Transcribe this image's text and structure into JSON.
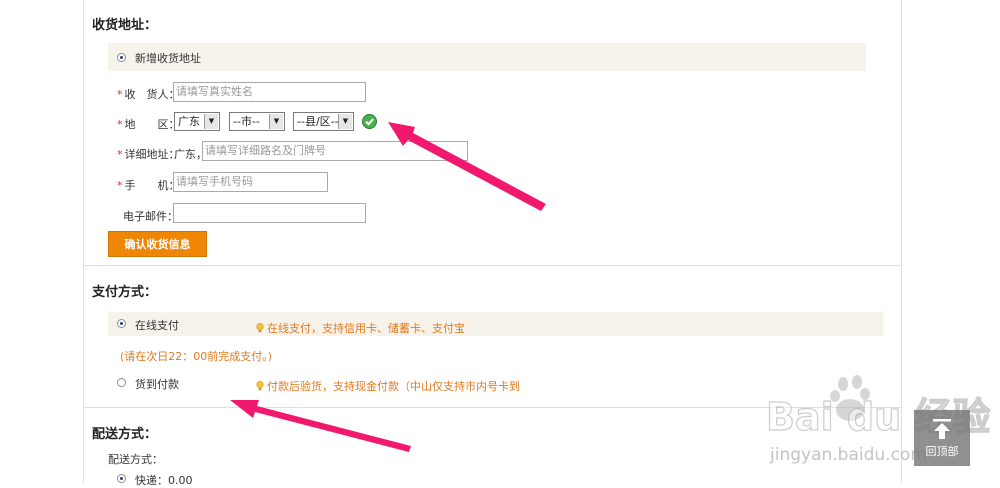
{
  "address_section": {
    "title": "收货地址：",
    "new_address_label": "新增收货地址",
    "receiver_label": "收　货人：",
    "receiver_placeholder": "请填写真实姓名",
    "region_label": "地　　区：",
    "province_selected": "广东",
    "city_selected": "--市--",
    "county_selected": "--县/区--",
    "detail_label": "详细地址：",
    "detail_prefix": "广东，",
    "detail_placeholder": "请填写详细路名及门牌号",
    "mobile_label": "手　　机：",
    "mobile_placeholder": "请填写手机号码",
    "email_label": "电子邮件：",
    "email_value": "",
    "confirm_button": "确认收货信息",
    "required_mark": "*"
  },
  "payment_section": {
    "title": "支付方式：",
    "online_label": "在线支付",
    "online_tip": "在线支付，支持信用卡、储蓄卡、支付宝",
    "deadline_note": "(请在次日22：00前完成支付。)",
    "cod_label": "货到付款",
    "cod_tip": "付款后验货，支持现金付款（中山仅支持市内号卡到"
  },
  "delivery_section": {
    "title": "配送方式：",
    "method_label": "配送方式：",
    "express_label": "快递：0.00"
  },
  "overlay": {
    "watermark_brand": "Bai du 经验",
    "watermark_url": "jingyan.baidu.com",
    "back_to_top": "回顶部"
  },
  "colors": {
    "accent_orange": "#ef8705",
    "tip_orange": "#e07a1e",
    "required_red": "#e0301e",
    "annotation_pink": "#f0196e",
    "band_beige": "#f7f2ea"
  }
}
